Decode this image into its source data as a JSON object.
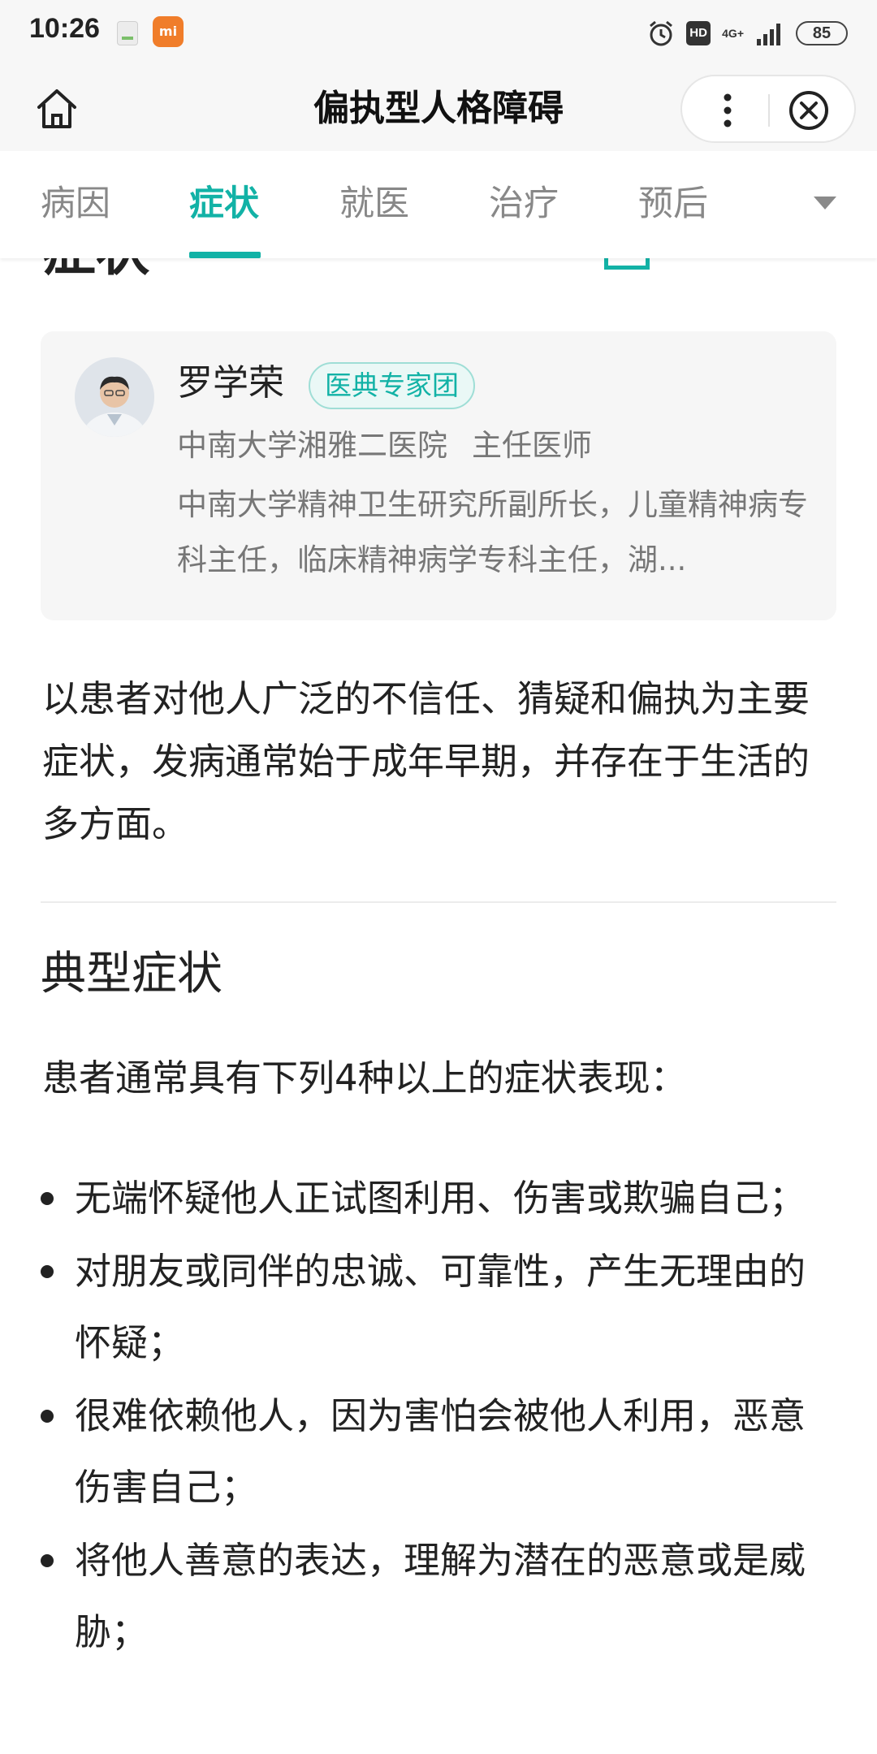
{
  "status_bar": {
    "time": "10:26",
    "notif_app_label": "mi",
    "hd_label": "HD",
    "network_label": "4G+",
    "battery": "85"
  },
  "header": {
    "title": "偏执型人格障碍"
  },
  "tabs": [
    {
      "label": "病因",
      "active": false
    },
    {
      "label": "症状",
      "active": true
    },
    {
      "label": "就医",
      "active": false
    },
    {
      "label": "治疗",
      "active": false
    },
    {
      "label": "预后",
      "active": false
    }
  ],
  "colors": {
    "accent": "#12b2a6",
    "text": "#222222",
    "muted": "#777777",
    "card_bg": "#f6f6f6"
  },
  "peek": {
    "heading": "症状"
  },
  "expert": {
    "name": "罗学荣",
    "badge": "医典专家团",
    "hospital": "中南大学湘雅二医院",
    "title": "主任医师",
    "bio": "中南大学精神卫生研究所副所长，儿童精神病专科主任，临床精神病学专科主任，湖..."
  },
  "intro": "以患者对他人广泛的不信任、猜疑和偏执为主要症状，发病通常始于成年早期，并存在于生活的多方面。",
  "typical_symptoms": {
    "title": "典型症状",
    "lead": "患者通常具有下列4种以上的症状表现：",
    "items": [
      "无端怀疑他人正试图利用、伤害或欺骗自己；",
      "对朋友或同伴的忠诚、可靠性，产生无理由的怀疑；",
      "很难依赖他人，因为害怕会被他人利用，恶意伤害自己；",
      "将他人善意的表达，理解为潜在的恶意或是威胁；"
    ]
  }
}
